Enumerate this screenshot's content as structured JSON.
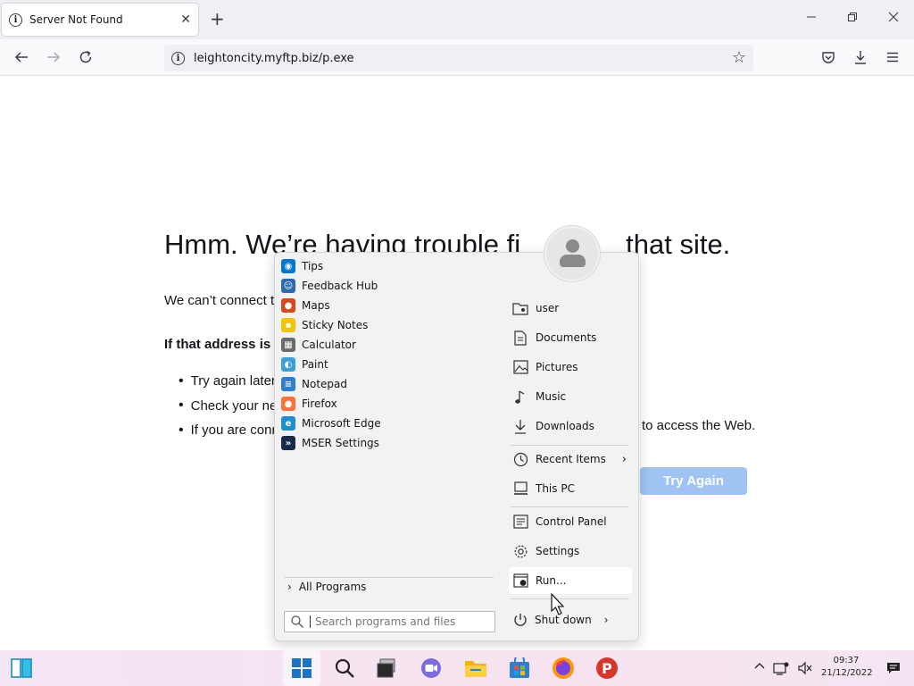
{
  "browser": {
    "tab_title": "Server Not Found",
    "tab_close": "✕",
    "new_tab": "+",
    "url": "leightoncity.myftp.biz/p.exe"
  },
  "error_page": {
    "title": "Hmm. We’re having trouble finding that site.",
    "title_visible": "Hmm. We’re having trouble fi",
    "title_tail": "that site.",
    "connect_text": "We can’t connect to",
    "bold_text": "If that address is",
    "bullets": [
      "Try again later",
      "Check your ne",
      "If you are conn"
    ],
    "bullet_tail": "to access the Web.",
    "try_again": "Try Again"
  },
  "start_menu": {
    "programs": [
      {
        "label": "Tips",
        "icon": "tips-icon",
        "color": "#0078d4"
      },
      {
        "label": "Feedback Hub",
        "icon": "feedback-hub-icon",
        "color": "#2b6cb0"
      },
      {
        "label": "Maps",
        "icon": "maps-icon",
        "color": "#d9481c"
      },
      {
        "label": "Sticky Notes",
        "icon": "sticky-notes-icon",
        "color": "#f3c400"
      },
      {
        "label": "Calculator",
        "icon": "calculator-icon",
        "color": "#6b6b6b"
      },
      {
        "label": "Paint",
        "icon": "paint-icon",
        "color": "#3aa0d8"
      },
      {
        "label": "Notepad",
        "icon": "notepad-icon",
        "color": "#2f7fd0"
      },
      {
        "label": "Firefox",
        "icon": "firefox-icon",
        "color": "#ff7139"
      },
      {
        "label": "Microsoft Edge",
        "icon": "edge-icon",
        "color": "#1d8fd1"
      },
      {
        "label": "MSER Settings",
        "icon": "mser-settings-icon",
        "color": "#1a2a4a"
      }
    ],
    "all_programs": "All Programs",
    "search_placeholder": "Search programs and files",
    "places": [
      {
        "label": "user",
        "icon": "user-folder-icon"
      },
      {
        "label": "Documents",
        "icon": "documents-icon"
      },
      {
        "label": "Pictures",
        "icon": "pictures-icon"
      },
      {
        "label": "Music",
        "icon": "music-icon"
      },
      {
        "label": "Downloads",
        "icon": "downloads-icon"
      },
      {
        "label": "Recent Items",
        "icon": "recent-items-icon"
      },
      {
        "label": "This PC",
        "icon": "this-pc-icon"
      },
      {
        "label": "Control Panel",
        "icon": "control-panel-icon"
      },
      {
        "label": "Settings",
        "icon": "settings-icon"
      },
      {
        "label": "Run...",
        "icon": "run-icon"
      }
    ],
    "shut_down": "Shut down"
  },
  "taskbar": {
    "time": "09:37",
    "date": "21/12/2022"
  }
}
